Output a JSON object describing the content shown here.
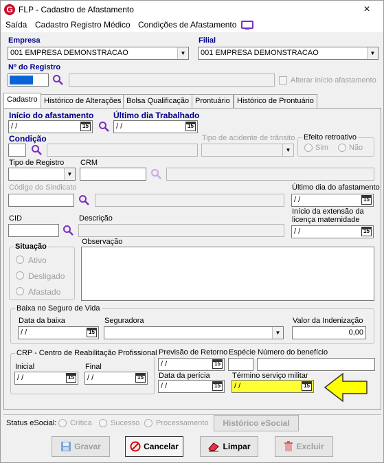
{
  "window": {
    "title": "FLP - Cadastro de Afastamento",
    "close": "×",
    "logo": "G"
  },
  "menu": {
    "items": [
      "Saída",
      "Cadastro Registro Médico",
      "Condições de Afastamento"
    ]
  },
  "header": {
    "empresa_label": "Empresa",
    "empresa_value": "001 EMPRESA DEMONSTRACAO",
    "filial_label": "Filial",
    "filial_value": "001 EMPRESA DEMONSTRACAO",
    "registro_label": "Nº do Registro",
    "alterar_label": "Alterar início afastamento"
  },
  "tabs": [
    "Cadastro",
    "Histórico de Alterações",
    "Bolsa Qualificação",
    "Prontuário",
    "Histórico de Prontuário"
  ],
  "form": {
    "inicio_label": "Início do afastamento",
    "inicio_value": " / /",
    "ultimo_trab_label": "Último dia Trabalhado",
    "ultimo_trab_value": " / /",
    "condicao_label": "Condição",
    "tipo_acidente_label": "Tipo de acidente de trânsito",
    "efeito_label": "Efeito retroativo",
    "sim_label": "Sim",
    "nao_label": "Não",
    "tipo_registro_label": "Tipo de Registro",
    "crm_label": "CRM",
    "sindicato_label": "Código do Sindicato",
    "ultimo_afast_label": "Último dia do afastamento",
    "ultimo_afast_value": " / /",
    "cid_label": "CID",
    "descricao_label": "Descrição",
    "extensao_label_1": "Início da extensão da",
    "extensao_label_2": "licença maternidade",
    "extensao_value": " / /",
    "situacao_label": "Situação",
    "situacao_options": [
      "Ativo",
      "Desligado",
      "Afastado"
    ],
    "observacao_label": "Observação",
    "baixa_group": "Baixa no Seguro de Vida",
    "data_baixa_label": "Data da baixa",
    "data_baixa_value": " / /",
    "seguradora_label": "Seguradora",
    "valor_indenizacao_label": "Valor da Indenização",
    "valor_indenizacao_value": "0,00",
    "crp_group": "CRP - Centro de Reabilitação Profissional",
    "inicial_label": "Inicial",
    "inicial_value": " / /",
    "final_label": "Final",
    "final_value": " / /",
    "previsao_label": "Previsão de Retorno",
    "previsao_value": " / /",
    "especie_label": "Espécie",
    "numero_beneficio_label": "Número do benefício",
    "data_pericia_label": "Data da perícia",
    "data_pericia_value": " / /",
    "termino_label": "Término serviço militar",
    "termino_value": " / /"
  },
  "status": {
    "label": "Status eSocial:",
    "options": [
      "Crítica",
      "Sucesso",
      "Processamento"
    ],
    "historico_button": "Histórico eSocial"
  },
  "buttons": {
    "gravar": "Gravar",
    "cancelar": "Cancelar",
    "limpar": "Limpar",
    "excluir": "Excluir"
  },
  "calendar_icon_text": "15",
  "colors": {
    "highlight": "#ffff33",
    "arrow": "#ffff00",
    "label_blue": "#00008b",
    "icon_purple": "#7b2fbe"
  }
}
